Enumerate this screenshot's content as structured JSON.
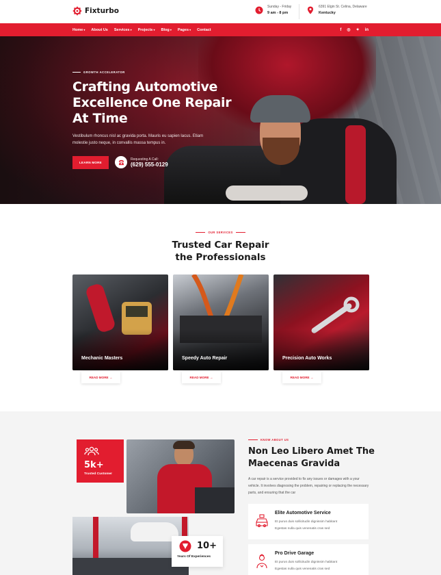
{
  "brand": {
    "name": "Fixturbo",
    "color": "#e21d2f"
  },
  "topbar": {
    "hours": {
      "icon": "clock-icon",
      "label": "Sunday - Friday",
      "value": "9 am - 8 pm"
    },
    "address": {
      "icon": "location-pin-icon",
      "label": "6391 Elgin St. Celina, Delaware",
      "value": "Kentucky"
    }
  },
  "nav": {
    "items": [
      {
        "label": "Home",
        "dropdown": true
      },
      {
        "label": "About Us",
        "dropdown": false
      },
      {
        "label": "Services",
        "dropdown": true
      },
      {
        "label": "Projects",
        "dropdown": true
      },
      {
        "label": "Blog",
        "dropdown": true
      },
      {
        "label": "Pages",
        "dropdown": true
      },
      {
        "label": "Contact",
        "dropdown": false
      }
    ],
    "social": [
      "f",
      "◎",
      "🐦",
      "in"
    ]
  },
  "hero": {
    "eyebrow": "GROWTH ACCELERATOR",
    "title": "Crafting Automotive Excellence One Repair At Time",
    "subtitle": "Vestibulum rhoncus nisl ac gravida porta. Mauris eu sapien lacus. Etiam molestie justo neque, in convallis massa tempus in.",
    "cta_label": "LEARN MORE",
    "call_label": "Requesting A Call:",
    "call_number": "(629) 555-0129"
  },
  "services": {
    "tag": "OUR SERVICES",
    "title": "Trusted Car Repair the Professionals",
    "cards": [
      {
        "label": "Mechanic Masters",
        "read_more": "READ MORE →"
      },
      {
        "label": "Speedy Auto Repair",
        "read_more": "READ MORE →"
      },
      {
        "label": "Precision Auto Works",
        "read_more": "READ MORE →"
      }
    ]
  },
  "about": {
    "tag": "KNOW ABOUT US",
    "title": "Non Leo Libero Amet The Maecenas Gravida",
    "paragraph": "A car repair is a service provided to fix any issues or damages with a your vehicle. It involves diagnosing the problem, repairing or replacing the necessary parts, and ensuring that the car",
    "stat_customers": {
      "value": "5k+",
      "label": "Trusted Customer"
    },
    "stat_experience": {
      "value": "10+",
      "label": "Years Of Experiences"
    },
    "features": [
      {
        "title": "Elite Automotive Service",
        "line1": "Et purus duis sollicitudin dignissim habitant",
        "line2": "Egestas nulla quis venenatis cras sed"
      },
      {
        "title": "Pro Drive Garage",
        "line1": "Et purus duis sollicitudin dignissim habitant",
        "line2": "Egestas nulla quis venenatis cras sed"
      }
    ]
  }
}
